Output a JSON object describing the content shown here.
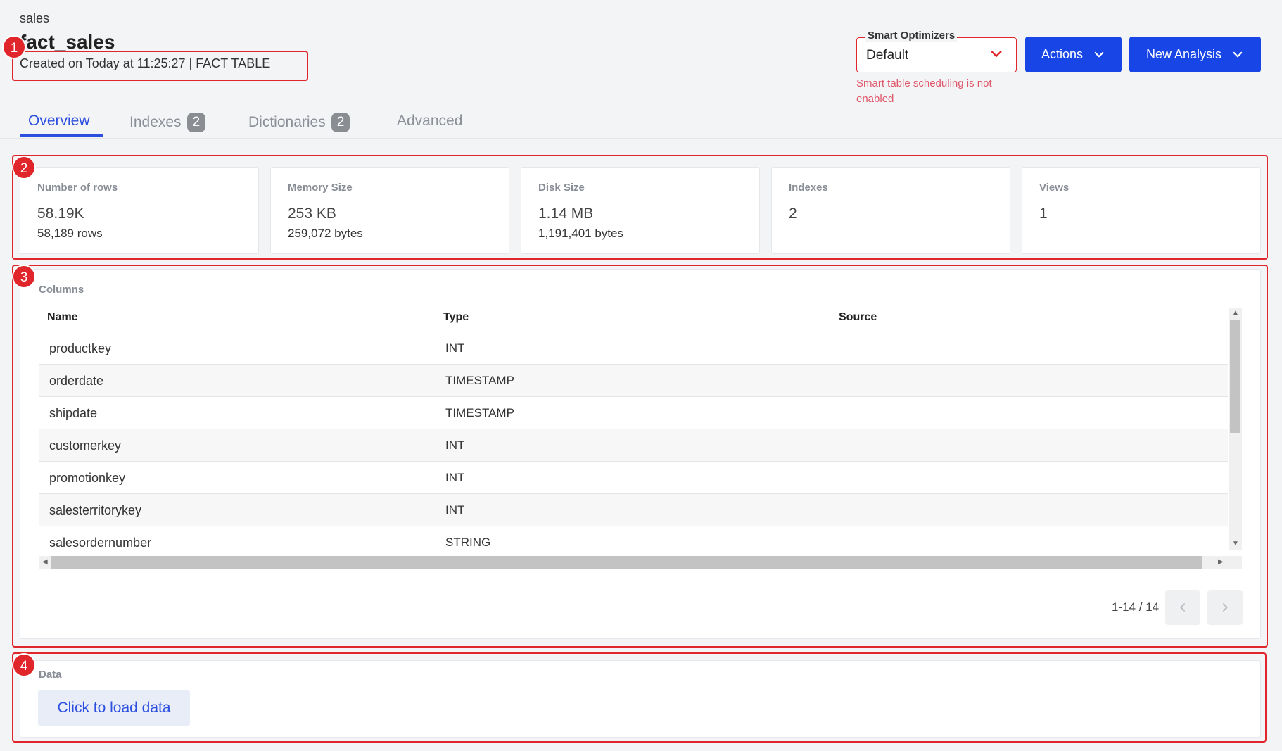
{
  "header": {
    "database": "sales",
    "table_name": "fact_sales",
    "created_info": "Created on Today at 11:25:27 | FACT TABLE"
  },
  "optimizer": {
    "legend": "Smart Optimizers",
    "value": "Default",
    "help_text": "Smart table scheduling is not enabled"
  },
  "actions": {
    "actions_label": "Actions",
    "new_analysis_label": "New Analysis"
  },
  "tabs": [
    {
      "label": "Overview",
      "badge": "",
      "active": true
    },
    {
      "label": "Indexes",
      "badge": "2",
      "active": false
    },
    {
      "label": "Dictionaries",
      "badge": "2",
      "active": false
    },
    {
      "label": "Advanced",
      "badge": "",
      "active": false
    }
  ],
  "stats": [
    {
      "label": "Number of rows",
      "value": "58.19K",
      "sub": "58,189 rows"
    },
    {
      "label": "Memory Size",
      "value": "253 KB",
      "sub": "259,072 bytes"
    },
    {
      "label": "Disk Size",
      "value": "1.14 MB",
      "sub": "1,191,401 bytes"
    },
    {
      "label": "Indexes",
      "value": "2",
      "sub": ""
    },
    {
      "label": "Views",
      "value": "1",
      "sub": ""
    }
  ],
  "columns": {
    "title": "Columns",
    "headers": {
      "name": "Name",
      "type": "Type",
      "source": "Source"
    },
    "rows": [
      {
        "name": "productkey",
        "type": "INT"
      },
      {
        "name": "orderdate",
        "type": "TIMESTAMP"
      },
      {
        "name": "shipdate",
        "type": "TIMESTAMP"
      },
      {
        "name": "customerkey",
        "type": "INT"
      },
      {
        "name": "promotionkey",
        "type": "INT"
      },
      {
        "name": "salesterritorykey",
        "type": "INT"
      },
      {
        "name": "salesordernumber",
        "type": "STRING"
      }
    ],
    "pagination": "1-14 / 14"
  },
  "data_section": {
    "title": "Data",
    "load_label": "Click to load data"
  },
  "annotations": [
    "1",
    "2",
    "3",
    "4"
  ],
  "colors": {
    "accent": "#1846e6",
    "annotation": "#e0262a",
    "help": "#e0566a"
  }
}
